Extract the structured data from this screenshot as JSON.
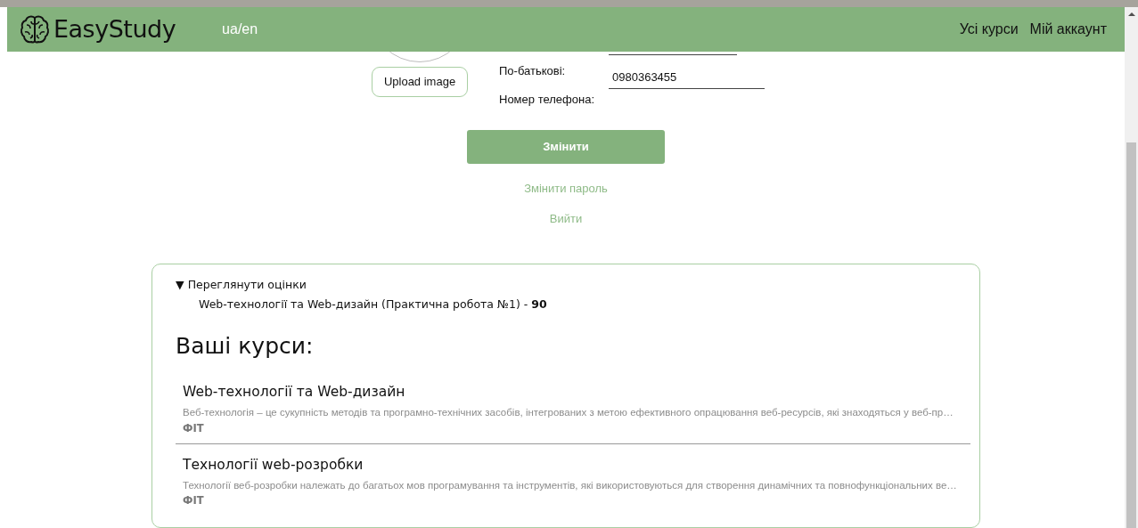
{
  "header": {
    "logo": "EasyStudy",
    "language": "ua/en",
    "nav": [
      "Усі курси",
      "Мій аккаунт"
    ]
  },
  "profile": {
    "upload_button": "Upload image",
    "labels": [
      "По-батькові:",
      "Номер телефона:"
    ],
    "field_value": "0980363455",
    "save_button": "Змінити",
    "links": [
      "Змінити пароль",
      "Вийти"
    ]
  },
  "grades": {
    "expanded": true,
    "marker": "▼",
    "summary": "Переглянути оцінки",
    "items": [
      "Web-технології та Web-дизайн (Практична робота №1) - **90**"
    ]
  },
  "courses": {
    "title": "Ваші курси:",
    "items": [
      {
        "title": "Web-технології та Web-дизайн",
        "description": "Веб-технологія – це сукупність методів та програмно-технічних засобів, інтегрованих з метою ефективного опрацювання веб-ресурсів, які знаходяться у веб-пр…",
        "faculty": "ФІТ"
      },
      {
        "title": "Технології web-розробки",
        "description": "Технології веб-розробки належать до багатьох мов програмування та інструментів, які використовуються для створення динамічних та повнофункціональних ве…",
        "faculty": "ФІТ"
      }
    ]
  }
}
